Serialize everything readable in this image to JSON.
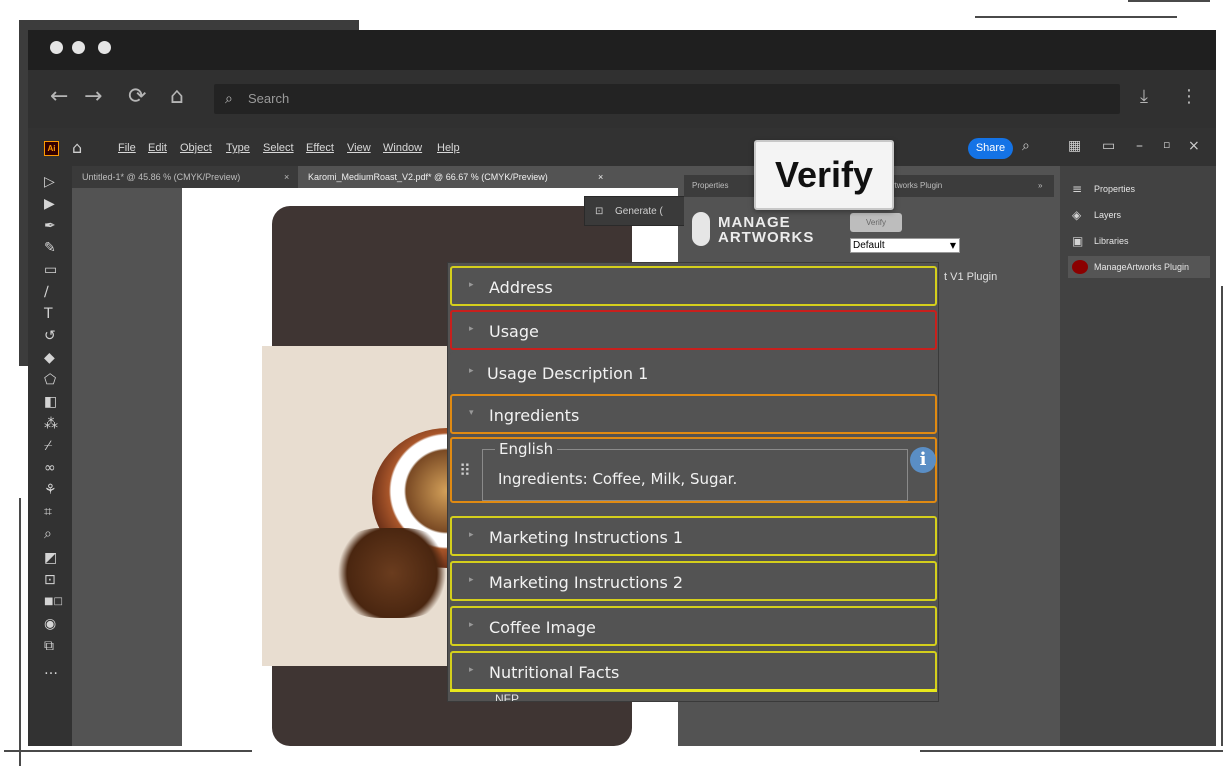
{
  "browser": {
    "nav": {
      "back_icon": "←",
      "forward_icon": "→",
      "reload_icon": "⟳",
      "home_icon": "⌂",
      "download_icon": "⤓",
      "menu_icon": "⋮"
    },
    "search_placeholder": "Search"
  },
  "illustrator": {
    "logo": "Ai",
    "menu": [
      "File",
      "Edit",
      "Object",
      "Type",
      "Select",
      "Effect",
      "View",
      "Window",
      "Help"
    ],
    "share_label": "Share",
    "doc_tabs": [
      {
        "label": "Untitled-1* @ 45.86 % (CMYK/Preview)",
        "active": false
      },
      {
        "label": "Karomi_MediumRoast_V2.pdf* @ 66.67 % (CMYK/Preview)",
        "active": true
      }
    ],
    "generate_label": "Generate (",
    "properties_tab": "Properties",
    "plugin_tab": "rtworks Plugin",
    "plugin_logo_line1": "MANAGE",
    "plugin_logo_line2": "ARTWORKS",
    "verify_small": "Verify",
    "select_value": "Default",
    "plugin_row": "t V1 Plugin",
    "right_panel": [
      {
        "label": "Properties",
        "icon": "≡"
      },
      {
        "label": "Layers",
        "icon": "◈"
      },
      {
        "label": "Libraries",
        "icon": "▣"
      },
      {
        "label": "ManageArtworks Plugin",
        "icon": "red-circle",
        "active": true
      }
    ]
  },
  "callout": {
    "verify_label": "Verify"
  },
  "accordion": {
    "sections": [
      {
        "label": "Address",
        "border": "yellow"
      },
      {
        "label": "Usage",
        "border": "red"
      },
      {
        "label": "Usage Description 1",
        "border": "none"
      },
      {
        "label": "Ingredients",
        "border": "orange",
        "expanded": true
      },
      {
        "label": "Marketing Instructions 1",
        "border": "yellow"
      },
      {
        "label": "Marketing Instructions 2",
        "border": "yellow"
      },
      {
        "label": "Coffee Image",
        "border": "yellow"
      },
      {
        "label": "Nutritional Facts",
        "border": "yellow"
      }
    ],
    "ingredients_field": {
      "language": "English",
      "value": "Ingredients: Coffee, Milk, Sugar."
    },
    "peek_label": "NFP"
  }
}
